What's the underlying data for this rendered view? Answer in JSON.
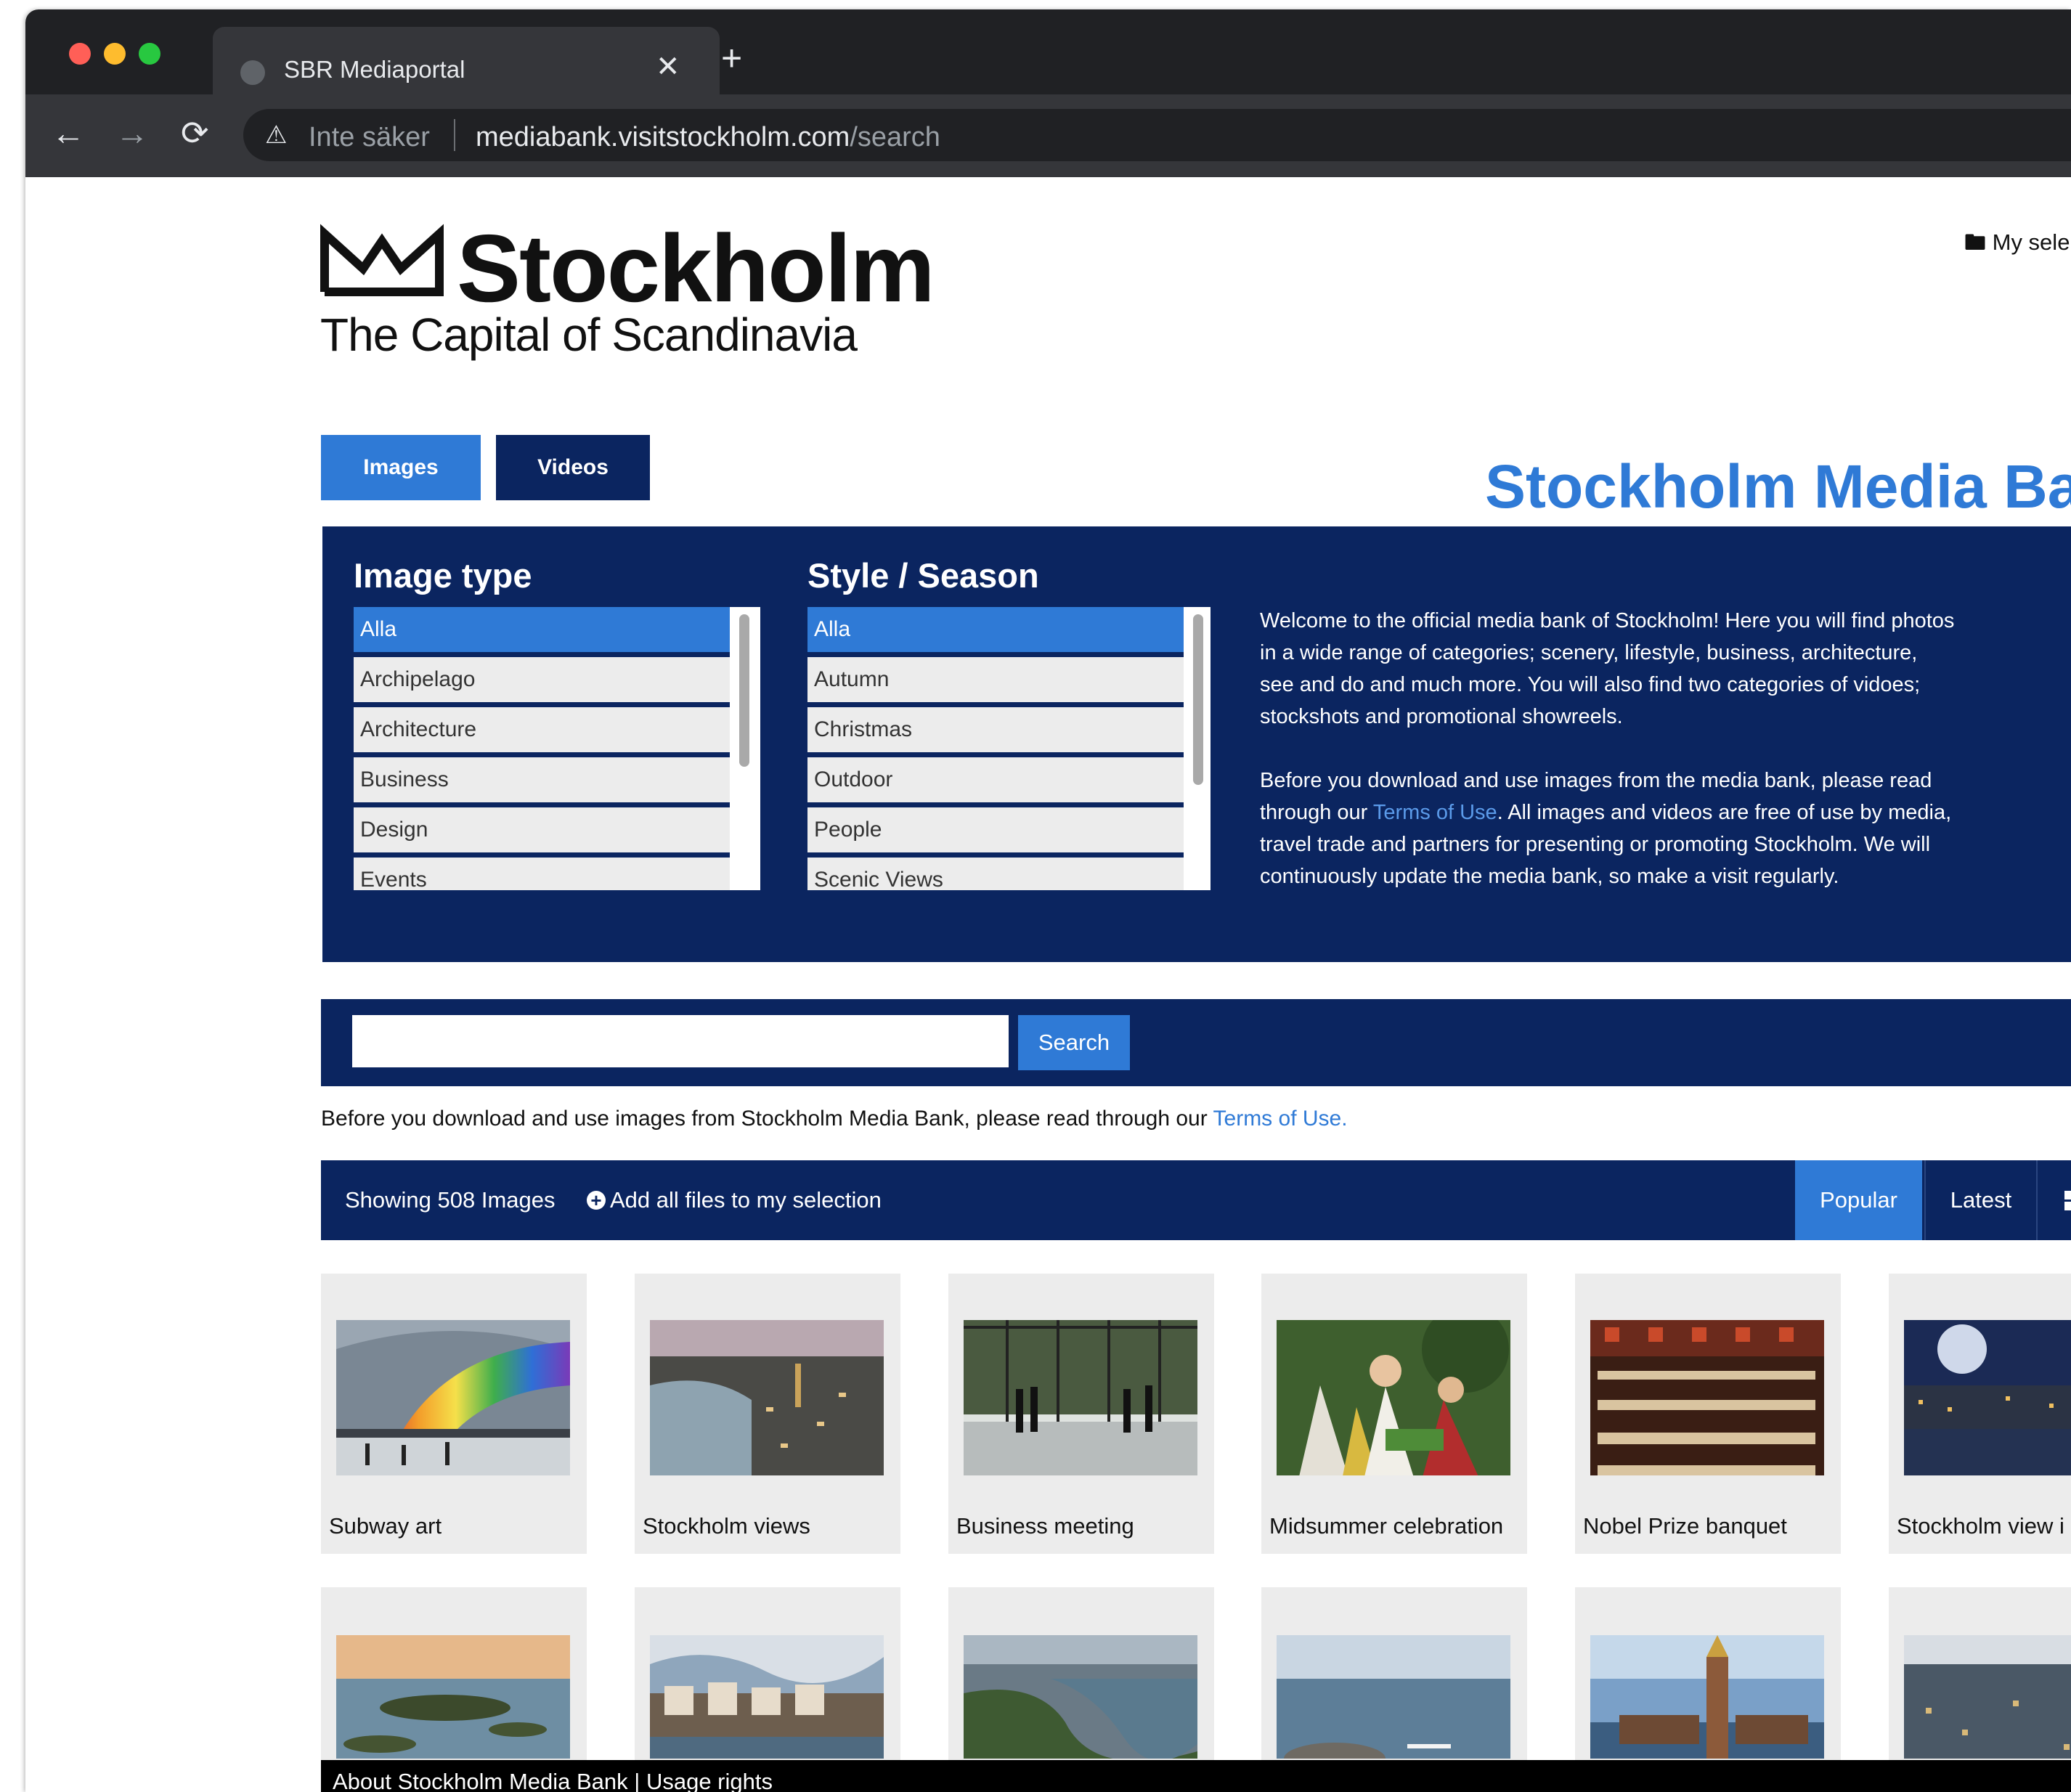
{
  "browser": {
    "tab_title": "SBR Mediaportal",
    "close_glyph": "✕",
    "new_tab_glyph": "+",
    "back_glyph": "←",
    "forward_glyph": "→",
    "reload_glyph": "⟳",
    "security_label": "Inte säker",
    "url_host": "mediabank.visitstockholm.com",
    "url_path": "/search",
    "traffic_light_colors": [
      "#ff5f57",
      "#febc2e",
      "#28c840"
    ]
  },
  "header": {
    "logo_wordmark": "Stockholm",
    "logo_tagline": "The Capital of Scandinavia",
    "my_selection": "My sele"
  },
  "tabs": {
    "images": "Images",
    "videos": "Videos"
  },
  "heading": "Stockholm Media Ba",
  "filters": {
    "image_type": {
      "title": "Image type",
      "options": [
        "Alla",
        "Archipelago",
        "Architecture",
        "Business",
        "Design",
        "Events"
      ],
      "selected": "Alla"
    },
    "style_season": {
      "title": "Style / Season",
      "options": [
        "Alla",
        "Autumn",
        "Christmas",
        "Outdoor",
        "People",
        "Scenic Views"
      ],
      "selected": "Alla"
    }
  },
  "intro": {
    "p1": "Welcome to the official media bank of Stockholm! Here you will find photos in a wide range of categories; scenery, lifestyle, business, architecture, see and do and much more. You will also find two categories of vidoes; stockshots and promotional showreels.",
    "p2_before": "Before you download and use images from the media bank, please read through our ",
    "p2_link": "Terms of Use",
    "p2_after": ". All images and videos are free of use by media, travel trade and partners for presenting or promoting Stockholm. We will continuously update the media bank, so make a visit regularly."
  },
  "search": {
    "value": "",
    "button": "Search"
  },
  "terms_line": {
    "before": "Before you download and use images from Stockholm Media Bank, please read through our ",
    "link": "Terms of Use."
  },
  "results": {
    "count_label": "Showing 508 Images",
    "add_all": "Add all files to my selection",
    "sort_popular": "Popular",
    "sort_latest": "Latest",
    "active_sort": "Popular"
  },
  "images": [
    {
      "caption": "Subway art",
      "scene": "subway"
    },
    {
      "caption": "Stockholm views",
      "scene": "city-dusk"
    },
    {
      "caption": "Business meeting",
      "scene": "office"
    },
    {
      "caption": "Midsummer celebration",
      "scene": "midsummer"
    },
    {
      "caption": "Nobel Prize banquet",
      "scene": "banquet"
    },
    {
      "caption": "Stockholm view i",
      "scene": "night-city"
    },
    {
      "caption": "",
      "scene": "archipelago"
    },
    {
      "caption": "",
      "scene": "waterfront"
    },
    {
      "caption": "",
      "scene": "aerial-green"
    },
    {
      "caption": "",
      "scene": "sea-rocks"
    },
    {
      "caption": "",
      "scene": "city-hall"
    },
    {
      "caption": "",
      "scene": "aerial-dusk"
    }
  ],
  "footer": {
    "about": "About Stockholm Media Bank",
    "separator": " | ",
    "usage": "Usage rights"
  },
  "colors": {
    "navy": "#0b2560",
    "accent_blue": "#2f7ad6",
    "chrome_dark": "#202124",
    "chrome_toolbar": "#35363a"
  }
}
